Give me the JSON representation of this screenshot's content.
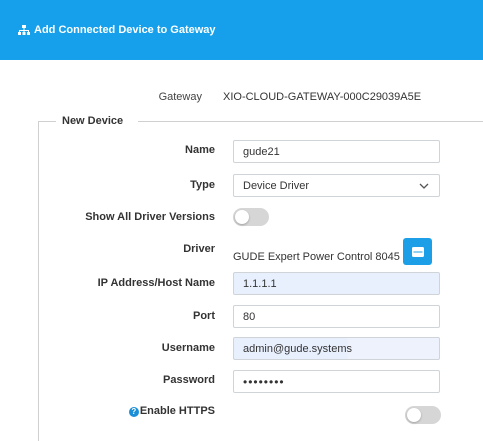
{
  "header": {
    "title": "Add Connected Device to Gateway",
    "icon": "network-icon",
    "color": "#16a0ec"
  },
  "gateway": {
    "label": "Gateway",
    "value": "XIO-CLOUD-GATEWAY-000C29039A5E"
  },
  "section": {
    "legend": "New Device"
  },
  "form": {
    "name": {
      "label": "Name",
      "value": "gude21"
    },
    "type": {
      "label": "Type",
      "value": "Device Driver"
    },
    "show_all_versions": {
      "label": "Show All Driver Versions",
      "enabled": false
    },
    "driver": {
      "label": "Driver",
      "value": "GUDE Expert Power Control 8045",
      "button_icon": "list-icon"
    },
    "ip": {
      "label": "IP Address/Host Name",
      "value": "1.1.1.1"
    },
    "port": {
      "label": "Port",
      "value": "80"
    },
    "username": {
      "label": "Username",
      "value": "admin@gude.systems"
    },
    "password": {
      "label": "Password",
      "value": "••••••••"
    },
    "https": {
      "label": "Enable HTTPS",
      "help_icon": "?",
      "enabled": false
    }
  }
}
